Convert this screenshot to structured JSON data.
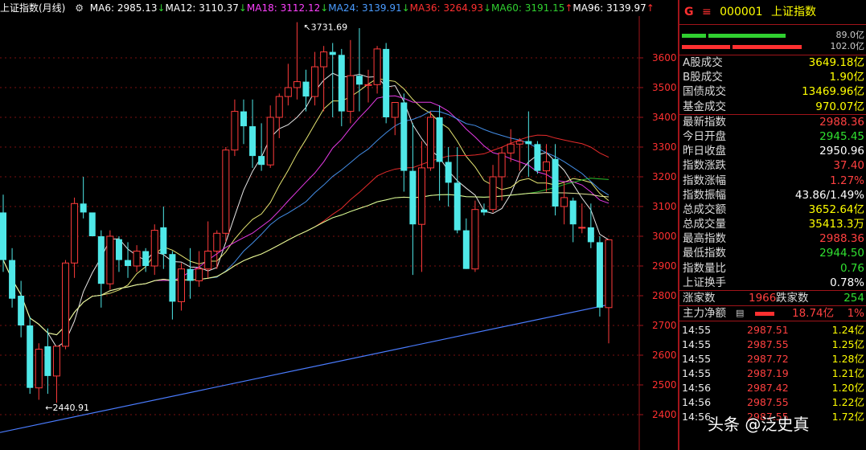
{
  "chart_data": {
    "type": "candlestick",
    "title": "上证指数(月线)",
    "ylim": [
      2330,
      3760
    ],
    "y_ticks": [
      2400,
      2500,
      2600,
      2700,
      2800,
      2900,
      3000,
      3100,
      3200,
      3300,
      3400,
      3500,
      3600
    ],
    "high_annotation": "3731.69",
    "low_annotation": "2440.91",
    "ma_labels": [
      {
        "text": "MA6: 2985.13",
        "arrow": "↓",
        "color": "#ffffff"
      },
      {
        "text": "MA12: 3110.37",
        "arrow": "↓",
        "color": "#ffffff"
      },
      {
        "text": "MA18: 3112.12",
        "arrow": "↓",
        "color": "#ff40ff"
      },
      {
        "text": "MA24: 3139.91",
        "arrow": "↓",
        "color": "#4a9cff"
      },
      {
        "text": "MA36: 3264.93",
        "arrow": "↓",
        "color": "#ff3030"
      },
      {
        "text": "MA60: 3191.15",
        "arrow": "↑",
        "color": "#30d030"
      },
      {
        "text": "MA96: 3139.97",
        "arrow": "↑",
        "color": "#ffffff"
      }
    ],
    "candles": [
      [
        3080,
        3140,
        2880,
        2920
      ],
      [
        2920,
        2960,
        2760,
        2790
      ],
      [
        2800,
        2850,
        2660,
        2700
      ],
      [
        2700,
        2730,
        2470,
        2490
      ],
      [
        2490,
        2640,
        2450,
        2620
      ],
      [
        2630,
        2690,
        2470,
        2530
      ],
      [
        2530,
        2630,
        2440,
        2630
      ],
      [
        2630,
        2920,
        2620,
        2910
      ],
      [
        2910,
        3130,
        2860,
        3110
      ],
      [
        3110,
        3200,
        3060,
        3080
      ],
      [
        3080,
        3000,
        3000,
        3000
      ],
      [
        3000,
        3020,
        2760,
        2840
      ],
      [
        2840,
        3020,
        2820,
        3000
      ],
      [
        2990,
        3000,
        2880,
        2920
      ],
      [
        2920,
        2980,
        2860,
        2900
      ],
      [
        2900,
        2970,
        2880,
        2950
      ],
      [
        2950,
        2960,
        2880,
        2900
      ],
      [
        2900,
        3040,
        2870,
        3020
      ],
      [
        3030,
        3100,
        2890,
        2940
      ],
      [
        2940,
        2950,
        2720,
        2780
      ],
      [
        2780,
        2910,
        2750,
        2890
      ],
      [
        2890,
        2960,
        2790,
        2850
      ],
      [
        2850,
        2950,
        2830,
        2890
      ],
      [
        2890,
        3050,
        2860,
        2950
      ],
      [
        2950,
        3020,
        2890,
        3010
      ],
      [
        3010,
        3300,
        2980,
        3290
      ],
      [
        3290,
        3460,
        3270,
        3420
      ],
      [
        3420,
        3460,
        3310,
        3370
      ],
      [
        3370,
        3460,
        3230,
        3270
      ],
      [
        3270,
        3380,
        3220,
        3240
      ],
      [
        3240,
        3440,
        3230,
        3400
      ],
      [
        3400,
        3480,
        3330,
        3470
      ],
      [
        3470,
        3580,
        3440,
        3500
      ],
      [
        3500,
        3720,
        3460,
        3520
      ],
      [
        3520,
        3560,
        3420,
        3470
      ],
      [
        3470,
        3620,
        3440,
        3570
      ],
      [
        3570,
        3640,
        3420,
        3620
      ],
      [
        3620,
        3650,
        3400,
        3610
      ],
      [
        3610,
        3630,
        3370,
        3420
      ],
      [
        3420,
        3660,
        3380,
        3540
      ],
      [
        3540,
        3700,
        3420,
        3510
      ],
      [
        3510,
        3560,
        3450,
        3510
      ],
      [
        3510,
        3640,
        3480,
        3630
      ],
      [
        3630,
        3650,
        3380,
        3400
      ],
      [
        3400,
        3450,
        3340,
        3450
      ],
      [
        3450,
        3480,
        3150,
        3220
      ],
      [
        3220,
        3380,
        2870,
        3040
      ],
      [
        3040,
        3320,
        2880,
        3230
      ],
      [
        3230,
        3420,
        3220,
        3400
      ],
      [
        3400,
        3440,
        3120,
        3250
      ],
      [
        3250,
        3300,
        3100,
        3180
      ],
      [
        3180,
        3300,
        3010,
        3020
      ],
      [
        3020,
        3060,
        2890,
        2890
      ],
      [
        2890,
        3120,
        2880,
        3090
      ],
      [
        3090,
        3110,
        3070,
        3080
      ],
      [
        3090,
        3240,
        3080,
        3200
      ],
      [
        3200,
        3300,
        3120,
        3280
      ],
      [
        3280,
        3360,
        3250,
        3310
      ],
      [
        3310,
        3330,
        3220,
        3320
      ],
      [
        3320,
        3420,
        3200,
        3310
      ],
      [
        3310,
        3320,
        3210,
        3220
      ],
      [
        3220,
        3310,
        3150,
        3250
      ],
      [
        3260,
        3310,
        3070,
        3100
      ],
      [
        3100,
        3180,
        3040,
        3130
      ],
      [
        3120,
        3130,
        2980,
        3040
      ],
      [
        3030,
        3110,
        3010,
        3030
      ],
      [
        3030,
        3110,
        2960,
        2980
      ],
      [
        2980,
        3000,
        2730,
        2760
      ],
      [
        2760,
        2990,
        2640,
        2988
      ]
    ]
  },
  "panel": {
    "g_label": "G",
    "menu_glyph": "≡",
    "code": "000001",
    "name": "上证指数",
    "top_bars": [
      {
        "value": "89.0亿"
      },
      {
        "value": "102.0亿"
      }
    ],
    "group1": [
      {
        "label": "A股成交",
        "value": "3649.18亿"
      },
      {
        "label": "B股成交",
        "value": "1.90亿"
      },
      {
        "label": "国债成交",
        "value": "13469.96亿"
      },
      {
        "label": "基金成交",
        "value": "970.07亿"
      }
    ],
    "group2": [
      {
        "label": "最新指数",
        "value": "2988.36",
        "color": "#ff4040"
      },
      {
        "label": "今日开盘",
        "value": "2945.45",
        "color": "#30e030"
      },
      {
        "label": "昨日收盘",
        "value": "2950.96",
        "color": "#ffffff"
      },
      {
        "label": "指数涨跌",
        "value": "37.40",
        "color": "#ff4040"
      },
      {
        "label": "指数涨幅",
        "value": "1.27%",
        "color": "#ff4040"
      },
      {
        "label": "指数振幅",
        "value": "43.86/1.49%",
        "color": "#ffffff"
      },
      {
        "label": "总成交额",
        "value": "3652.64亿",
        "color": "#ffff00"
      },
      {
        "label": "总成交量",
        "value": "35413.3万",
        "color": "#ffff00"
      },
      {
        "label": "最高指数",
        "value": "2988.36",
        "color": "#ff4040"
      },
      {
        "label": "最低指数",
        "value": "2944.50",
        "color": "#30e030"
      },
      {
        "label": "指数量比",
        "value": "0.76",
        "color": "#30e030"
      },
      {
        "label": "上证换手",
        "value": "0.78%",
        "color": "#ffffff"
      }
    ],
    "up_label": "涨家数",
    "up_value": "1966",
    "down_label": "跌家数",
    "down_value": "254",
    "fund_label": "主力净额",
    "fund_value": "18.74亿",
    "fund_pct": "1%",
    "ticks": [
      {
        "time": "14:55",
        "price": "2987.51",
        "vol": "1.24亿"
      },
      {
        "time": "14:55",
        "price": "2987.55",
        "vol": "1.25亿"
      },
      {
        "time": "14:55",
        "price": "2987.72",
        "vol": "1.28亿"
      },
      {
        "time": "14:55",
        "price": "2987.19",
        "vol": "1.21亿"
      },
      {
        "time": "14:56",
        "price": "2987.42",
        "vol": "1.20亿"
      },
      {
        "time": "14:56",
        "price": "2987.55",
        "vol": "1.22亿"
      },
      {
        "time": "14:56",
        "price": "2987.55",
        "vol": "1.72亿"
      }
    ]
  },
  "watermark": "头条 @泛史真"
}
